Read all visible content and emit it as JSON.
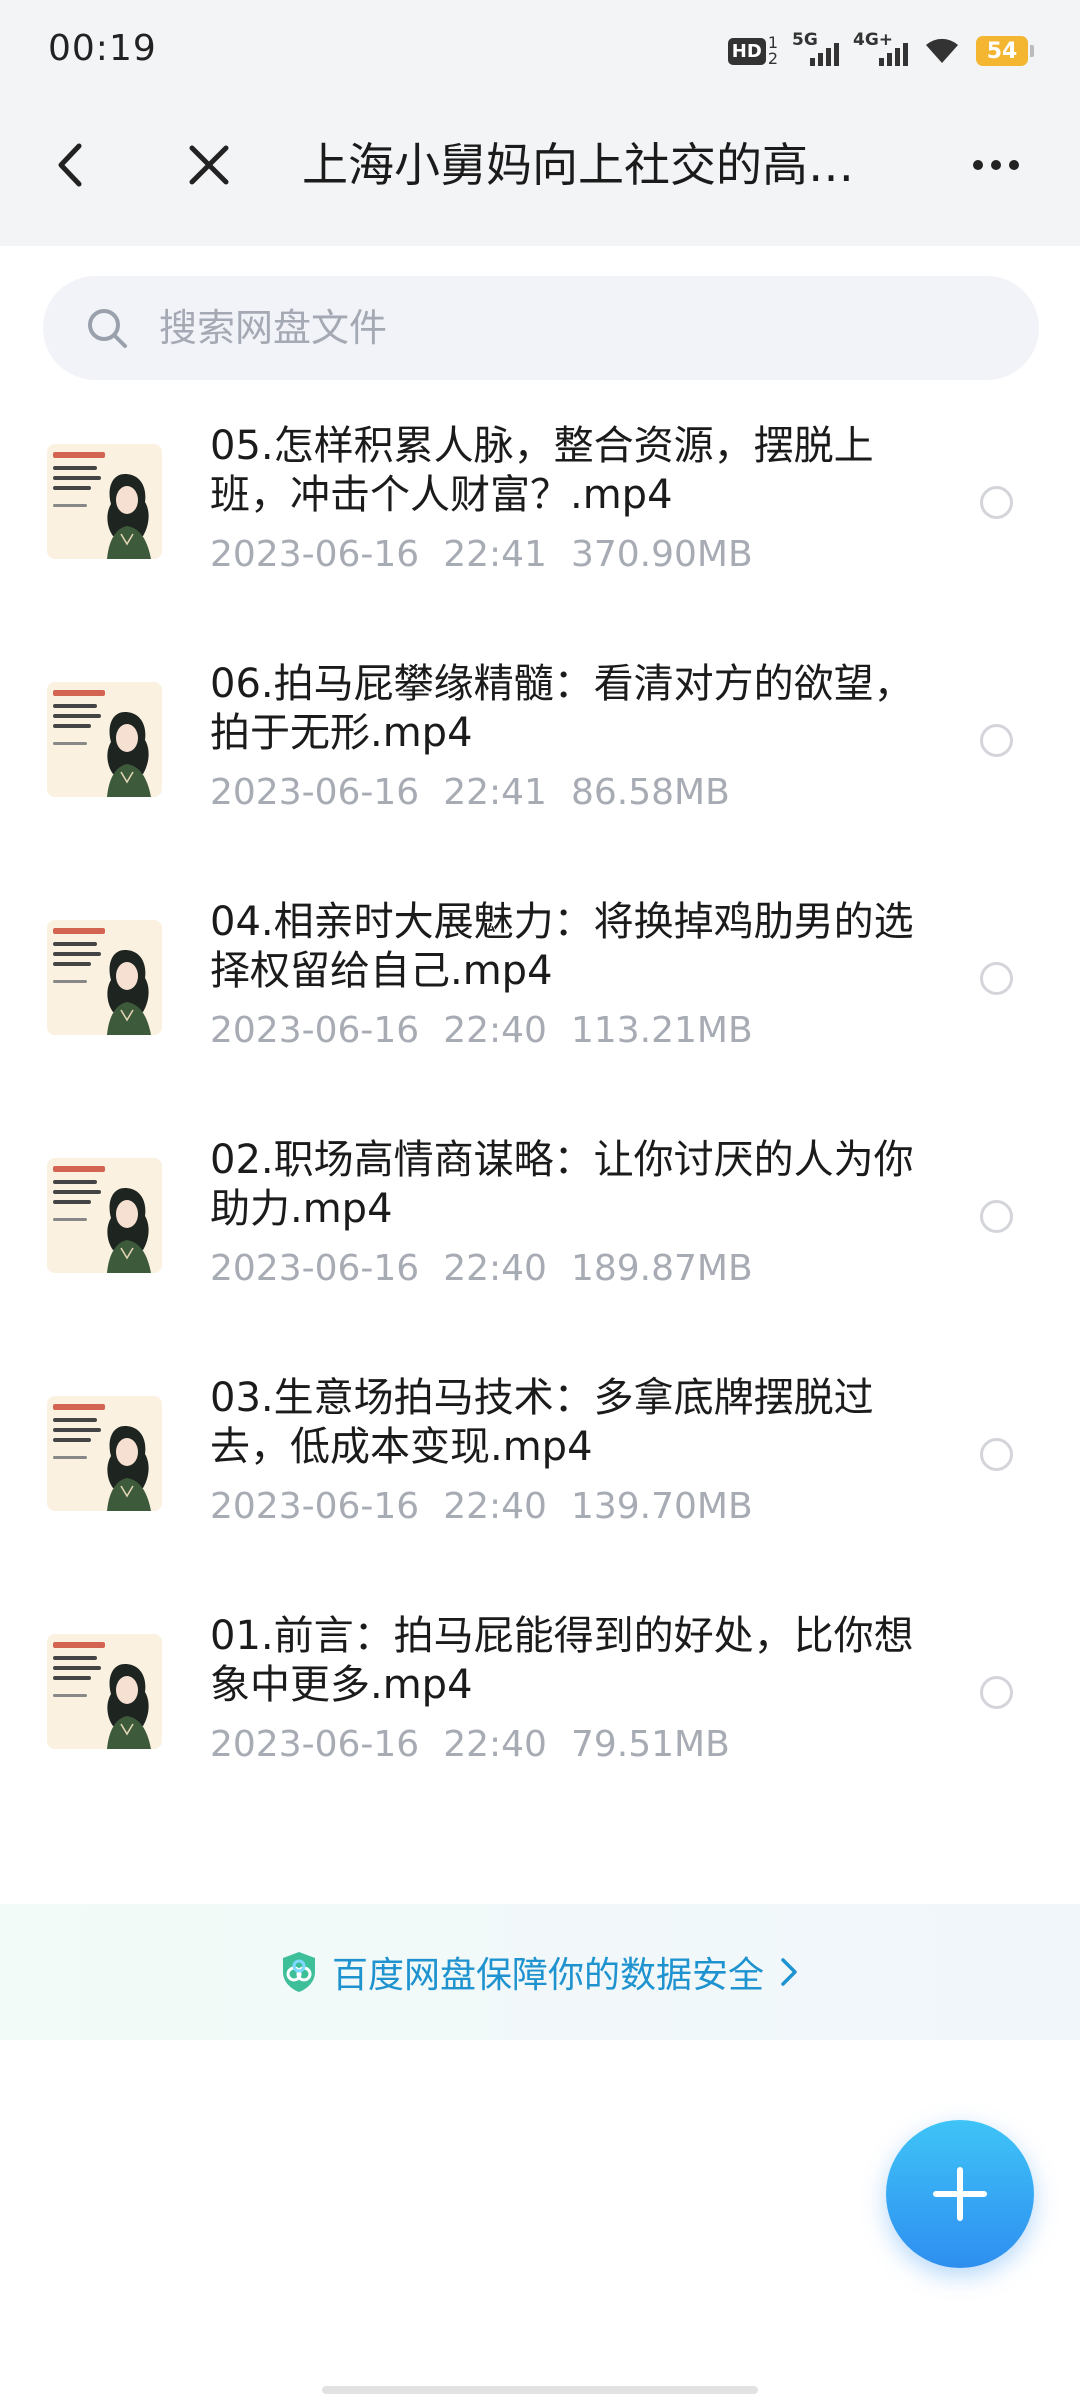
{
  "status_bar": {
    "time": "00:19",
    "hd_label": "HD",
    "hd_sim": "1",
    "hd_sim2": "2",
    "network_1": "5G",
    "network_2": "4G+",
    "battery": "54",
    "battery_color": "#f4b530"
  },
  "header": {
    "title": "上海小舅妈向上社交的高…",
    "back_icon": "chevron-left-icon",
    "close_icon": "close-icon",
    "more_icon": "more-dots-icon"
  },
  "search": {
    "placeholder": "搜索网盘文件",
    "icon": "search-icon"
  },
  "files": [
    {
      "name": "05.怎样积累人脉，整合资源，摆脱上班，冲击个人财富？.mp4",
      "date": "2023-06-16",
      "time": "22:41",
      "size": "370.90MB"
    },
    {
      "name": "06.拍马屁攀缘精髓：看清对方的欲望，拍于无形.mp4",
      "date": "2023-06-16",
      "time": "22:41",
      "size": "86.58MB"
    },
    {
      "name": "04.相亲时大展魅力：将换掉鸡肋男的选择权留给自己.mp4",
      "date": "2023-06-16",
      "time": "22:40",
      "size": "113.21MB"
    },
    {
      "name": "02.职场高情商谋略：让你讨厌的人为你助力.mp4",
      "date": "2023-06-16",
      "time": "22:40",
      "size": "189.87MB"
    },
    {
      "name": "03.生意场拍马技术：多拿底牌摆脱过去，低成本变现.mp4",
      "date": "2023-06-16",
      "time": "22:40",
      "size": "139.70MB"
    },
    {
      "name": "01.前言：拍马屁能得到的好处，比你想象中更多.mp4",
      "date": "2023-06-16",
      "time": "22:40",
      "size": "79.51MB"
    }
  ],
  "security": {
    "text": "百度网盘保障你的数据安全",
    "color": "#1f93cf"
  },
  "fab": {
    "icon": "plus-icon",
    "color": "#2e8ef0"
  }
}
